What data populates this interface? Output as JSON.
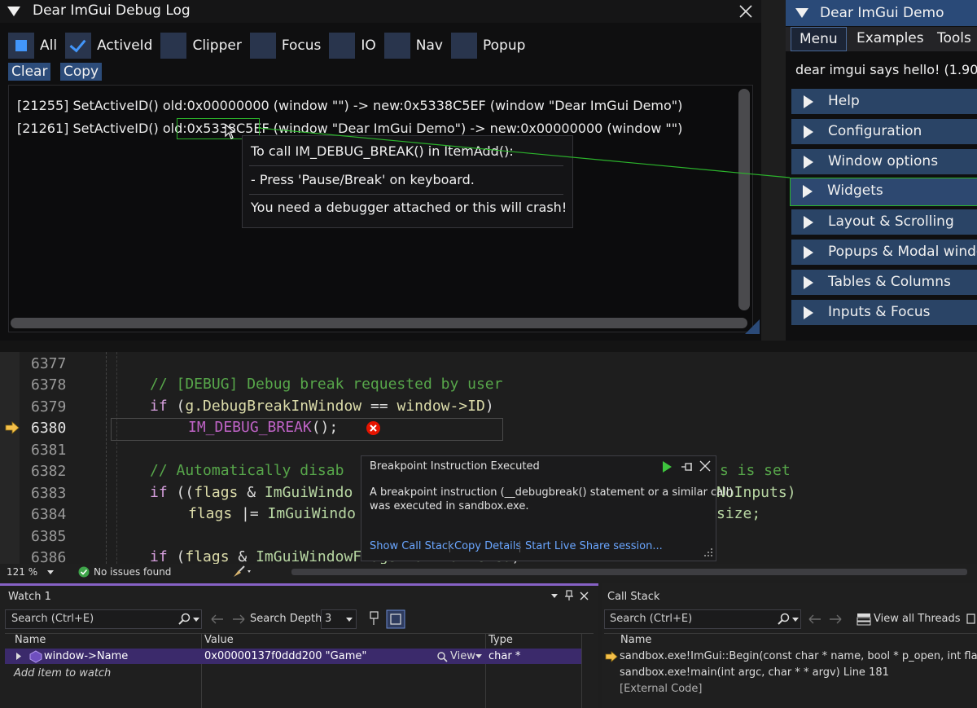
{
  "debug_log": {
    "title": "Dear ImGui Debug Log",
    "filters": [
      {
        "label": "All",
        "state": "partial"
      },
      {
        "label": "ActiveId",
        "state": "checked"
      },
      {
        "label": "Clipper",
        "state": "unchecked"
      },
      {
        "label": "Focus",
        "state": "unchecked"
      },
      {
        "label": "IO",
        "state": "unchecked"
      },
      {
        "label": "Nav",
        "state": "unchecked"
      },
      {
        "label": "Popup",
        "state": "unchecked"
      }
    ],
    "buttons": {
      "clear": "Clear",
      "copy": "Copy"
    },
    "lines": [
      "[21255] SetActiveID() old:0x00000000 (window \"\") -> new:0x5338C5EF (window \"Dear ImGui Demo\")",
      "[21261] SetActiveID() old:0x5338C5EF (window \"Dear ImGui Demo\") -> new:0x00000000 (window \"\")"
    ],
    "tooltip": [
      "To call IM_DEBUG_BREAK() in ItemAdd():",
      "- Press 'Pause/Break' on keyboard.",
      "You need a debugger attached or this will crash!"
    ]
  },
  "demo": {
    "title": "Dear ImGui Demo",
    "menu": [
      "Menu",
      "Examples",
      "Tools"
    ],
    "hello": "dear imgui says hello! (1.90.",
    "headers": [
      "Help",
      "Configuration",
      "Window options",
      "Widgets",
      "Layout & Scrolling",
      "Popups & Modal windo",
      "Tables & Columns",
      "Inputs & Focus"
    ],
    "hovered_header": "Widgets"
  },
  "editor": {
    "line_numbers": [
      "6377",
      "6378",
      "6379",
      "6380",
      "6381",
      "6382",
      "6383",
      "6384",
      "6385",
      "6386"
    ],
    "current_line": "6380",
    "code": {
      "l6378": "// [DEBUG] Debug break requested by user",
      "l6379_kw": "if",
      "l6379_a": " (",
      "l6379_b": "g.DebugBreakInWindow",
      "l6379_c": " == ",
      "l6379_d": "window->ID",
      "l6379_e": ")",
      "l6380_mac": "IM_DEBUG_BREAK",
      "l6380_rest": "();",
      "l6382": "// Automatically disab",
      "l6382_tail": "s is set",
      "l6383_kw": "if",
      "l6383_a": " ((",
      "l6383_b": "flags",
      "l6383_c": " & ",
      "l6383_d": "ImGuiWindo",
      "l6383_tail": "NoInputs)",
      "l6384_a": "flags",
      "l6384_b": " |= ",
      "l6384_c": "ImGuiWindo",
      "l6384_tail": "size;",
      "l6386_kw": "if",
      "l6386_a": " (",
      "l6386_b": "flags",
      "l6386_c": " & ",
      "l6386_d": "ImGuiWindowFlags_NavFlattened",
      "l6386_e": ")"
    },
    "exception": {
      "title": "Breakpoint Instruction Executed",
      "message_1": "A breakpoint instruction (__debugbreak() statement or a similar call)",
      "message_2": "was executed in sandbox.exe.",
      "links": [
        "Show Call Stack",
        "Copy Details",
        "Start Live Share session..."
      ]
    }
  },
  "status": {
    "zoom": "121 %",
    "issues": "No issues found"
  },
  "watch": {
    "title": "Watch 1",
    "search_placeholder": "Search (Ctrl+E)",
    "search_depth_label": "Search Depth:",
    "search_depth_value": "3",
    "columns": [
      "Name",
      "Value",
      "Type"
    ],
    "row": {
      "name": "window->Name",
      "value": "0x00000137f0ddd200 \"Game\"",
      "view": "View",
      "type": "char *"
    },
    "add_item": "Add item to watch"
  },
  "callstack": {
    "title": "Call Stack",
    "search_placeholder": "Search (Ctrl+E)",
    "view_all_threads": "View all Threads",
    "column": "Name",
    "frames": [
      "sandbox.exe!ImGui::Begin(const char * name, bool * p_open, int flags",
      "sandbox.exe!main(int argc, char * * argv) Line 181",
      "[External Code]"
    ]
  },
  "colors": {
    "imgui_accent": "#4296fa",
    "imgui_header": "#2a4466",
    "hover_link": "#2cb52c",
    "vs_comment": "#57a64a",
    "vs_keyword": "#d8a0df",
    "vs_link": "#6aa6ff"
  }
}
